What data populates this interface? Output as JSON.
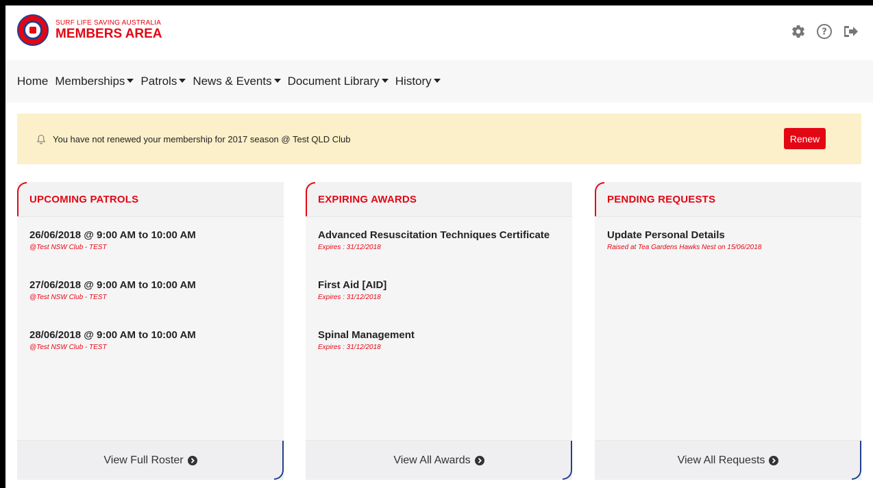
{
  "brand": {
    "subtitle": "SURF LIFE SAVING AUSTRALIA",
    "title": "MEMBERS AREA"
  },
  "header_icons": [
    "gear-icon",
    "help-icon",
    "sign-out-icon"
  ],
  "nav": [
    {
      "label": "Home",
      "dropdown": false
    },
    {
      "label": "Memberships",
      "dropdown": true
    },
    {
      "label": "Patrols",
      "dropdown": true
    },
    {
      "label": "News & Events",
      "dropdown": true
    },
    {
      "label": "Document Library",
      "dropdown": true
    },
    {
      "label": "History",
      "dropdown": true
    }
  ],
  "alert": {
    "icon": "bell-icon",
    "text": "You have not renewed your membership for 2017 season @ Test QLD Club",
    "button": "Renew"
  },
  "panels": [
    {
      "title": "UPCOMING PATROLS",
      "items": [
        {
          "title": "26/06/2018 @ 9:00 AM to 10:00 AM",
          "sub": "@Test NSW Club - TEST"
        },
        {
          "title": "27/06/2018 @ 9:00 AM to 10:00 AM",
          "sub": "@Test NSW Club - TEST"
        },
        {
          "title": "28/06/2018 @ 9:00 AM to 10:00 AM",
          "sub": "@Test NSW Club - TEST"
        }
      ],
      "footer": "View Full Roster"
    },
    {
      "title": "EXPIRING AWARDS",
      "items": [
        {
          "title": "Advanced Resuscitation Techniques Certificate",
          "sub": "Expires : 31/12/2018"
        },
        {
          "title": "First Aid [AID]",
          "sub": "Expires : 31/12/2018"
        },
        {
          "title": "Spinal Management",
          "sub": "Expires : 31/12/2018"
        }
      ],
      "footer": "View All Awards"
    },
    {
      "title": "PENDING REQUESTS",
      "items": [
        {
          "title": "Update Personal Details",
          "sub": "Raised at Tea Gardens Hawks Nest on 15/06/2018"
        }
      ],
      "footer": "View All Requests"
    }
  ],
  "colors": {
    "brand_red": "#e30613",
    "brand_blue": "#1f3f8f",
    "alert_bg": "#fbf0c9"
  }
}
